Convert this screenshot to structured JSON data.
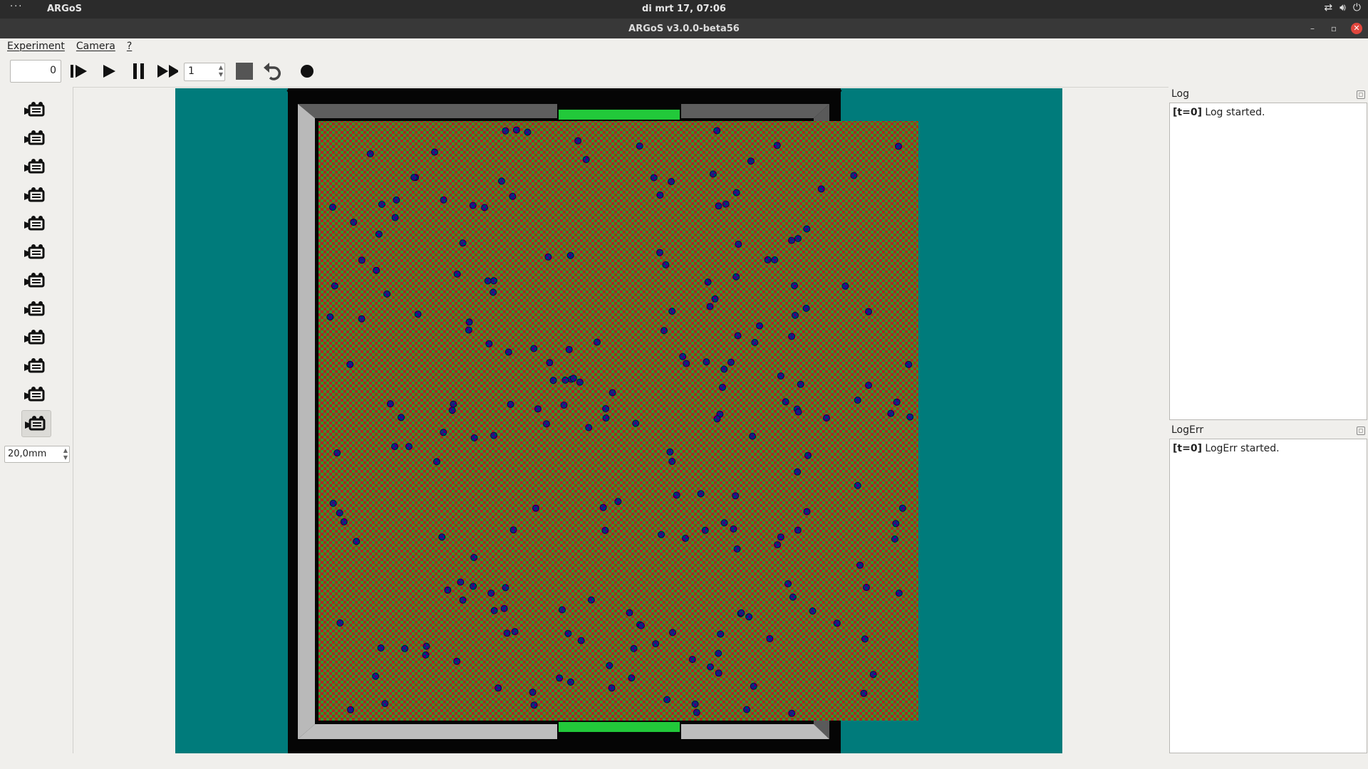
{
  "system_bar": {
    "dots": "···",
    "app_name": "ARGoS",
    "clock": "di mrt 17, 07:06"
  },
  "window": {
    "title": "ARGoS v3.0.0-beta56",
    "minimize_label": "–",
    "maximize_label": "▫",
    "close_label": "✕"
  },
  "menu": {
    "experiment": "Experiment",
    "camera": "Camera",
    "help": "?"
  },
  "toolbar": {
    "step_counter": "0",
    "step_buttons": [
      "step-icon",
      "play-icon",
      "pause-icon",
      "fast-forward-icon"
    ],
    "fast_forward_steps": "1",
    "stop_icon": "stop-icon",
    "reset_icon": "reset-icon",
    "record_icon": "record-icon"
  },
  "camera_panel": {
    "camera_count": 12,
    "selected_camera": 12,
    "focal_length": "20,0mm"
  },
  "log": {
    "title": "Log",
    "prefix": "[t=0]",
    "message": "Log started."
  },
  "logerr": {
    "title": "LogErr",
    "prefix": "[t=0]",
    "message": "LogErr started."
  },
  "arena": {
    "floor_colors": [
      "#b02323",
      "#2e9a2e"
    ],
    "wall_color": "#8e8e8e",
    "background_color": "#007b7b",
    "robot_color": "#1a1a7a",
    "robot_count": 220,
    "nest_color": "#22c93a"
  }
}
